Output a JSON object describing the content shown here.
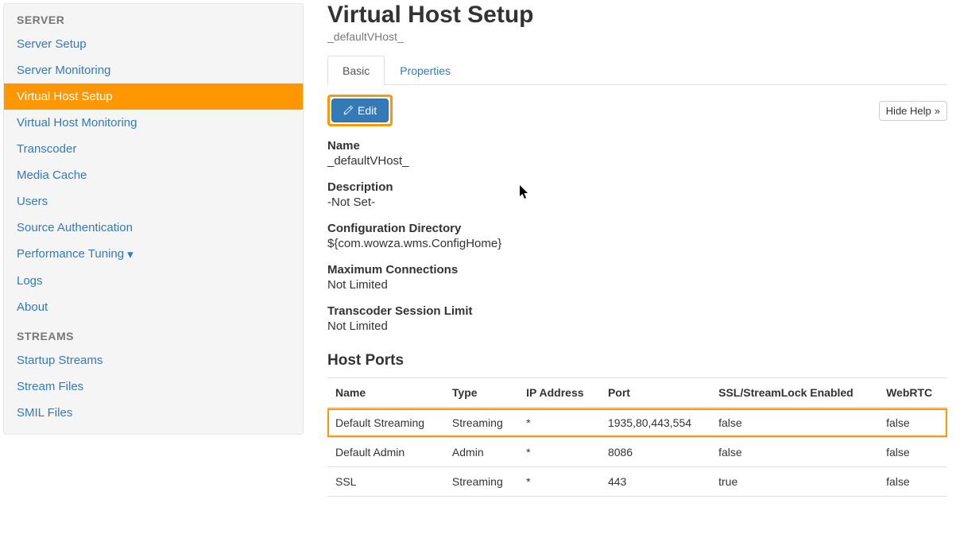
{
  "sidebar": {
    "sections": [
      {
        "header": "SERVER",
        "items": [
          {
            "label": "Server Setup",
            "id": "server-setup"
          },
          {
            "label": "Server Monitoring",
            "id": "server-monitoring"
          },
          {
            "label": "Virtual Host Setup",
            "id": "virtual-host-setup",
            "active": true
          },
          {
            "label": "Virtual Host Monitoring",
            "id": "virtual-host-monitoring"
          },
          {
            "label": "Transcoder",
            "id": "transcoder"
          },
          {
            "label": "Media Cache",
            "id": "media-cache"
          },
          {
            "label": "Users",
            "id": "users"
          },
          {
            "label": "Source Authentication",
            "id": "source-authentication"
          },
          {
            "label": "Performance Tuning",
            "id": "performance-tuning",
            "dropdown": true
          },
          {
            "label": "Logs",
            "id": "logs"
          },
          {
            "label": "About",
            "id": "about"
          }
        ]
      },
      {
        "header": "STREAMS",
        "items": [
          {
            "label": "Startup Streams",
            "id": "startup-streams"
          },
          {
            "label": "Stream Files",
            "id": "stream-files"
          },
          {
            "label": "SMIL Files",
            "id": "smil-files"
          }
        ]
      }
    ]
  },
  "page": {
    "title": "Virtual Host Setup",
    "subtitle": "_defaultVHost_"
  },
  "tabs": [
    {
      "label": "Basic",
      "active": true
    },
    {
      "label": "Properties",
      "active": false
    }
  ],
  "actions": {
    "edit": "Edit",
    "hideHelp": "Hide Help"
  },
  "fields": [
    {
      "label": "Name",
      "value": "_defaultVHost_"
    },
    {
      "label": "Description",
      "value": "-Not Set-"
    },
    {
      "label": "Configuration Directory",
      "value": "${com.wowza.wms.ConfigHome}"
    },
    {
      "label": "Maximum Connections",
      "value": "Not Limited"
    },
    {
      "label": "Transcoder Session Limit",
      "value": "Not Limited"
    }
  ],
  "hostPorts": {
    "title": "Host Ports",
    "columns": [
      "Name",
      "Type",
      "IP Address",
      "Port",
      "SSL/StreamLock Enabled",
      "WebRTC"
    ],
    "rows": [
      {
        "cells": [
          "Default Streaming",
          "Streaming",
          "*",
          "1935,80,443,554",
          "false",
          "false"
        ],
        "highlight": true
      },
      {
        "cells": [
          "Default Admin",
          "Admin",
          "*",
          "8086",
          "false",
          "false"
        ]
      },
      {
        "cells": [
          "SSL",
          "Streaming",
          "*",
          "443",
          "true",
          "false"
        ]
      }
    ]
  }
}
